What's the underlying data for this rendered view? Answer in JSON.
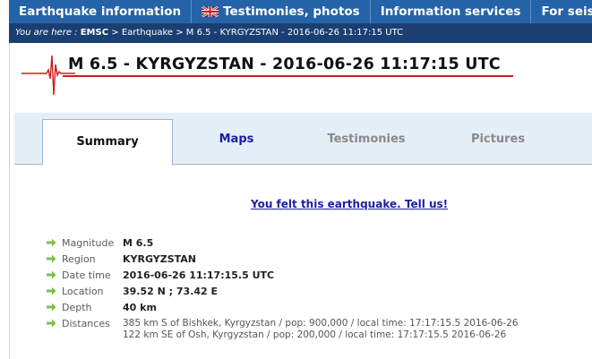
{
  "nav": {
    "items": [
      {
        "label": "Earthquake information"
      },
      {
        "label": "Testimonies, photos"
      },
      {
        "label": "Information services"
      },
      {
        "label": "For seismolo"
      }
    ]
  },
  "breadcrumb": {
    "prefix": "You are here :",
    "root": "EMSC",
    "sep1": ">",
    "section": "Earthquake",
    "sep2": ">",
    "current": "M 6.5 - KYRGYZSTAN - 2016-06-26 11:17:15 UTC"
  },
  "page": {
    "title": "M 6.5 - KYRGYZSTAN - 2016-06-26 11:17:15 UTC"
  },
  "tabs": [
    {
      "label": "Summary"
    },
    {
      "label": "Maps"
    },
    {
      "label": "Testimonies"
    },
    {
      "label": "Pictures"
    }
  ],
  "felt_link": "You felt this earthquake. Tell us!",
  "details": {
    "magnitude": {
      "label": "Magnitude",
      "value": "M 6.5"
    },
    "region": {
      "label": "Region",
      "value": "KYRGYZSTAN"
    },
    "datetime": {
      "label": "Date time",
      "value": "2016-06-26 11:17:15.5 UTC"
    },
    "location": {
      "label": "Location",
      "value": "39.52 N ; 73.42 E"
    },
    "depth": {
      "label": "Depth",
      "value": "40 km"
    },
    "distances": {
      "label": "Distances",
      "lines": [
        "385 km S of Bishkek, Kyrgyzstan / pop: 900,000 / local time: 17:17:15.5 2016-06-26",
        "122 km SE of Osh, Kyrgyzstan / pop: 200,000 / local time: 17:17:15.5 2016-06-26"
      ]
    }
  },
  "colors": {
    "nav_bg": "#2563a8",
    "breadcrumb_bg": "#1b3f73",
    "title_underline": "#cc1c1c",
    "link": "#1a1fa6",
    "arrow": "#7cc242"
  },
  "icons": {
    "flag": "uk-flag-icon",
    "seismogram": "seismogram-icon",
    "bullet": "green-arrow-icon"
  }
}
